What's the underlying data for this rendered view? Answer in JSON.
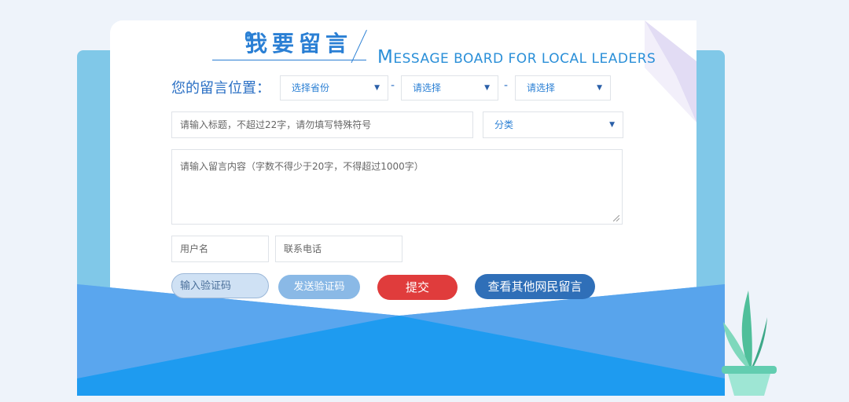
{
  "header": {
    "title_cn": "我要留言",
    "title_en_initial": "M",
    "title_en_rest": "ESSAGE BOARD FOR LOCAL LEADERS"
  },
  "location": {
    "label": "您的留言位置：",
    "province_placeholder": "选择省份",
    "city_placeholder": "请选择",
    "county_placeholder": "请选择",
    "separator": "-"
  },
  "form": {
    "title_placeholder": "请输入标题，不超过22字，请勿填写特殊符号",
    "category_placeholder": "分类",
    "content_placeholder": "请输入留言内容（字数不得少于20字，不得超过1000字）",
    "username_placeholder": "用户名",
    "phone_placeholder": "联系电话",
    "captcha_placeholder": "输入验证码"
  },
  "buttons": {
    "send_code": "发送验证码",
    "submit": "提交",
    "view_others": "查看其他网民留言"
  },
  "colors": {
    "accent_blue": "#2a7fd4",
    "submit_red": "#e03c3c",
    "view_blue": "#2f6fb8",
    "send_code_blue": "#8ab9e6",
    "envelope_blue": "#1e9bf0"
  }
}
